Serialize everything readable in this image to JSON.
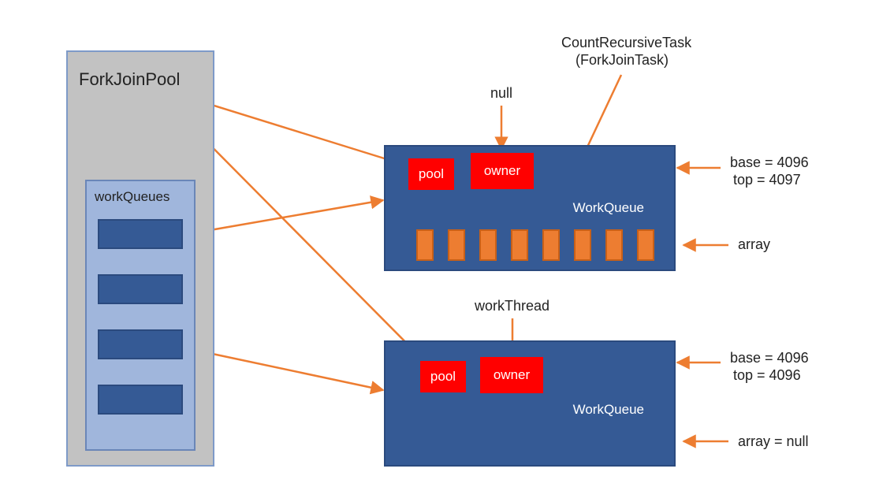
{
  "forkJoinPool": {
    "title": "ForkJoinPool"
  },
  "workQueuesContainer": {
    "title": "workQueues",
    "slotCount": 4
  },
  "workQueueTop": {
    "poolLabel": "pool",
    "ownerLabel": "owner",
    "ownerValueLabel": "null",
    "classLabel": "WorkQueue",
    "baseText": "base = 4096",
    "topText": "top = 4097",
    "arrayLabel": "array",
    "arrayCellCount": 8,
    "taskLabel1": "CountRecursiveTask",
    "taskLabel2": "(ForkJoinTask)"
  },
  "workQueueBottom": {
    "poolLabel": "pool",
    "ownerLabel": "owner",
    "ownerValueLabel": "workThread",
    "classLabel": "WorkQueue",
    "baseText": "base = 4096",
    "topText": "top = 4096",
    "arrayLabel": "array = null"
  }
}
